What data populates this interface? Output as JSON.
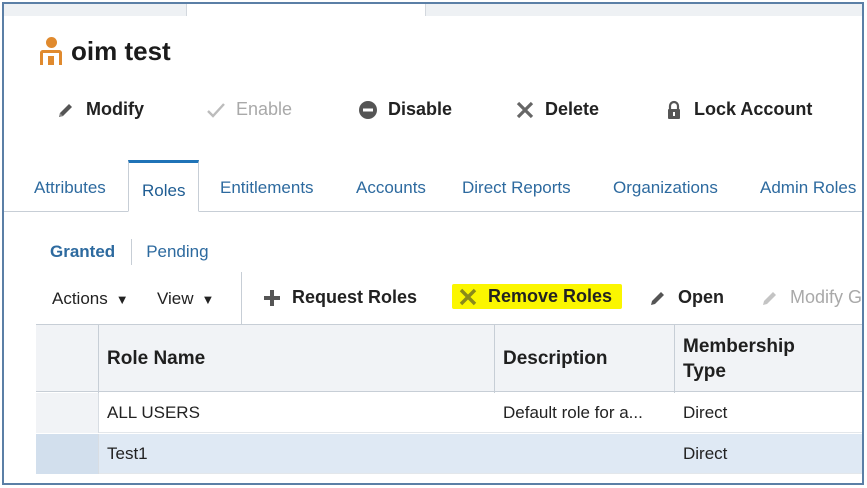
{
  "user": {
    "name": "oim test",
    "icon": "user-icon"
  },
  "toolbar": {
    "modify": "Modify",
    "enable": "Enable",
    "disable": "Disable",
    "delete": "Delete",
    "lock": "Lock Account"
  },
  "tabs": [
    {
      "label": "Attributes",
      "active": false
    },
    {
      "label": "Roles",
      "active": true
    },
    {
      "label": "Entitlements",
      "active": false
    },
    {
      "label": "Accounts",
      "active": false
    },
    {
      "label": "Direct Reports",
      "active": false
    },
    {
      "label": "Organizations",
      "active": false
    },
    {
      "label": "Admin Roles",
      "active": false
    }
  ],
  "subtabs": [
    {
      "label": "Granted",
      "active": true
    },
    {
      "label": "Pending",
      "active": false
    }
  ],
  "actionbar": {
    "actions": "Actions",
    "view": "View",
    "request_roles": "Request Roles",
    "remove_roles": "Remove Roles",
    "open": "Open",
    "modify_grant": "Modify G"
  },
  "table": {
    "headers": {
      "role_name": "Role Name",
      "description": "Description",
      "membership_line1": "Membership",
      "membership_line2": "Type"
    },
    "rows": [
      {
        "role_name": "ALL USERS",
        "description": "Default role for a...",
        "membership_type": "Direct",
        "selected": false
      },
      {
        "role_name": "Test1",
        "description": "",
        "membership_type": "Direct",
        "selected": true
      }
    ]
  },
  "colors": {
    "accent": "#1f73b7",
    "link": "#2d6a9f",
    "user_icon": "#e08a2e",
    "highlight": "#fbf600",
    "selected_row": "#dfe9f4",
    "frame_border": "#5b7fa6"
  }
}
